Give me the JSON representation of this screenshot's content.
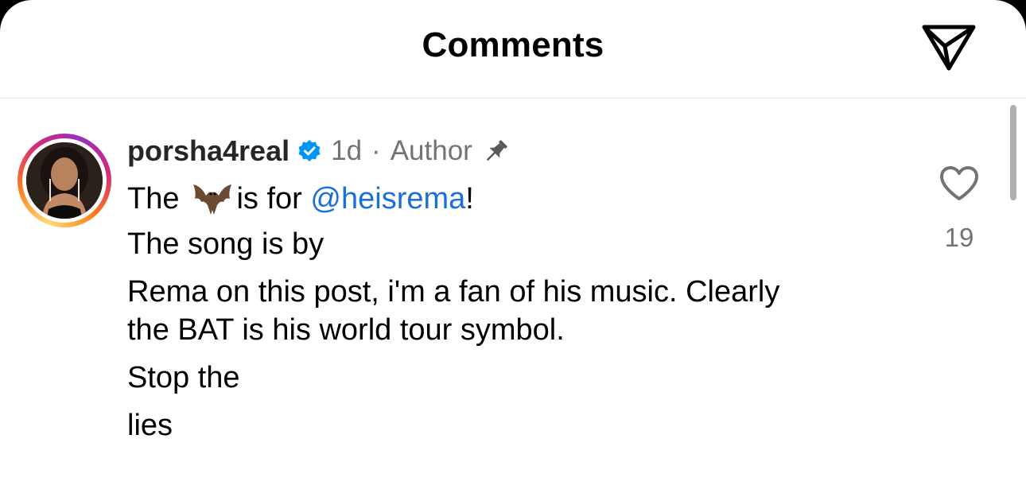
{
  "header": {
    "title": "Comments",
    "share_icon": "paper-plane-icon"
  },
  "comment": {
    "username": "porsha4real",
    "verified_icon": "verified-badge-icon",
    "time": "1d",
    "separator": "·",
    "role": "Author",
    "pin_icon": "pin-icon",
    "text_the": "The",
    "emoji_icon": "bat-emoji",
    "text_is_for": "is for",
    "mention": "@heisrema",
    "text_exclaim": "!",
    "line2": "The song is by",
    "line3": "Rema on this post, i'm a fan of his music. Clearly",
    "line4": "the BAT is his world tour symbol.",
    "line5": "Stop the",
    "line6": "lies",
    "like_icon": "heart-outline-icon",
    "like_count": "19"
  },
  "colors": {
    "mention": "#1a6fd8",
    "verified": "#0095f6",
    "secondary_text": "#737373"
  }
}
